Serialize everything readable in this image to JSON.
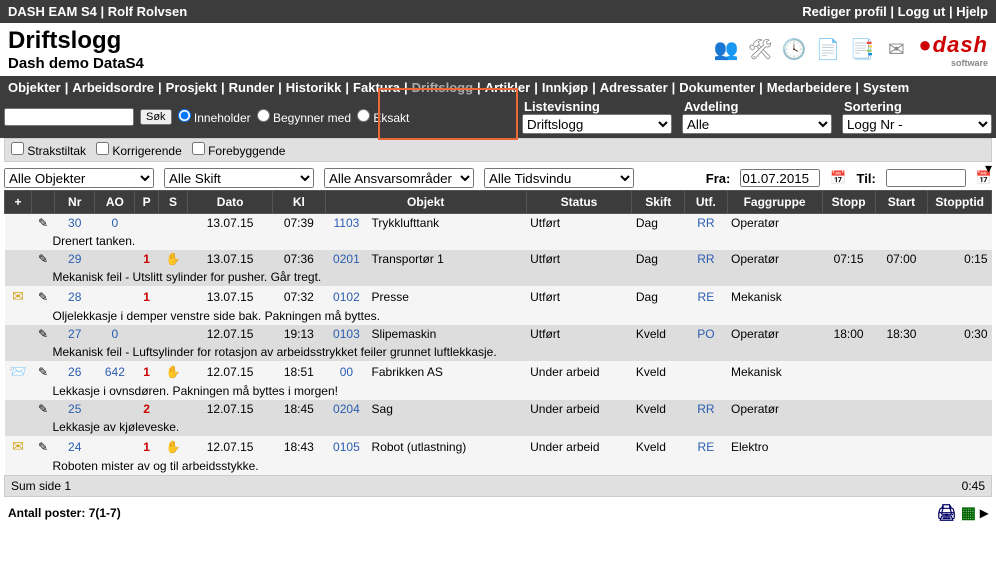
{
  "topbar": {
    "app": "DASH EAM S4",
    "user": "Rolf Rolvsen",
    "links": [
      "Rediger profil",
      "Logg ut",
      "Hjelp"
    ]
  },
  "title": "Driftslogg",
  "subtitle": "Dash demo DataS4",
  "logo": {
    "main": "dash",
    "sub": "software"
  },
  "nav": [
    "Objekter",
    "Arbeidsordre",
    "Prosjekt",
    "Runder",
    "Historikk",
    "Faktura",
    "Driftslogg",
    "Artikler",
    "Innkjøp",
    "Adressater",
    "Dokumenter",
    "Medarbeidere",
    "System"
  ],
  "nav_active": "Driftslogg",
  "search": {
    "button": "Søk",
    "mode_labels": [
      "Inneholder",
      "Begynner med",
      "Eksakt"
    ],
    "checked_mode": 0
  },
  "selectors": {
    "listevisning": {
      "label": "Listevisning",
      "value": "Driftslogg"
    },
    "avdeling": {
      "label": "Avdeling",
      "value": "Alle"
    },
    "sortering": {
      "label": "Sortering",
      "value": "Logg Nr -"
    }
  },
  "filters": {
    "strakstiltak": "Strakstiltak",
    "korrigerende": "Korrigerende",
    "forebyggende": "Forebyggende"
  },
  "dropdowns": {
    "objekter": "Alle Objekter",
    "skift": "Alle Skift",
    "ansvar": "Alle Ansvarsområder",
    "tidsvindu": "Alle Tidsvindu"
  },
  "date": {
    "fra_label": "Fra:",
    "fra_value": "01.07.2015",
    "til_label": "Til:",
    "til_value": ""
  },
  "columns": {
    "plus": "+",
    "nr": "Nr",
    "ao": "AO",
    "p": "P",
    "s": "S",
    "dato": "Dato",
    "kl": "Kl",
    "objekt": "Objekt",
    "status": "Status",
    "skift": "Skift",
    "utf": "Utf.",
    "fag": "Faggruppe",
    "stopp": "Stopp",
    "start": "Start",
    "stopptid": "Stopptid"
  },
  "rows": [
    {
      "mail": false,
      "edit": true,
      "nr": "30",
      "ao": "0",
      "p": "",
      "s": "",
      "dato": "13.07.15",
      "kl": "07:39",
      "objkode": "1103",
      "objekt": "Trykklufttank",
      "status": "Utført",
      "skift": "Dag",
      "utf": "RR",
      "fag": "Operatør",
      "stopp": "",
      "start": "",
      "stopptid": "",
      "desc": "Drenert tanken."
    },
    {
      "mail": false,
      "edit": true,
      "nr": "29",
      "ao": "",
      "p": "1",
      "s": "hand",
      "dato": "13.07.15",
      "kl": "07:36",
      "objkode": "0201",
      "objekt": "Transportør 1",
      "status": "Utført",
      "skift": "Dag",
      "utf": "RR",
      "fag": "Operatør",
      "stopp": "07:15",
      "start": "07:00",
      "stopptid": "0:15",
      "desc": "Mekanisk feil - Utslitt sylinder for pusher. Går tregt."
    },
    {
      "mail": true,
      "edit": true,
      "nr": "28",
      "ao": "",
      "p": "1",
      "s": "",
      "dato": "13.07.15",
      "kl": "07:32",
      "objkode": "0102",
      "objekt": "Presse",
      "status": "Utført",
      "skift": "Dag",
      "utf": "RE",
      "fag": "Mekanisk",
      "stopp": "",
      "start": "",
      "stopptid": "",
      "desc": "Oljelekkasje i demper venstre side bak. Pakningen må byttes."
    },
    {
      "mail": false,
      "edit": true,
      "nr": "27",
      "ao": "0",
      "p": "",
      "s": "",
      "dato": "12.07.15",
      "kl": "19:13",
      "objkode": "0103",
      "objekt": "Slipemaskin",
      "status": "Utført",
      "skift": "Kveld",
      "utf": "PO",
      "fag": "Operatør",
      "stopp": "18:00",
      "start": "18:30",
      "stopptid": "0:30",
      "desc": "Mekanisk feil - Luftsylinder for rotasjon av arbeidsstrykket feiler grunnet luftlekkasje."
    },
    {
      "mail": "open",
      "edit": true,
      "nr": "26",
      "ao": "642",
      "p": "1",
      "s": "hand",
      "dato": "12.07.15",
      "kl": "18:51",
      "objkode": "00",
      "objekt": "Fabrikken AS",
      "status": "Under arbeid",
      "skift": "Kveld",
      "utf": "",
      "fag": "Mekanisk",
      "stopp": "",
      "start": "",
      "stopptid": "",
      "desc": "Lekkasje i ovnsdøren. Pakningen må byttes i morgen!"
    },
    {
      "mail": false,
      "edit": true,
      "nr": "25",
      "ao": "",
      "p": "2",
      "s": "",
      "dato": "12.07.15",
      "kl": "18:45",
      "objkode": "0204",
      "objekt": "Sag",
      "status": "Under arbeid",
      "skift": "Kveld",
      "utf": "RR",
      "fag": "Operatør",
      "stopp": "",
      "start": "",
      "stopptid": "",
      "desc": "Lekkasje av kjøleveske."
    },
    {
      "mail": true,
      "edit": true,
      "nr": "24",
      "ao": "",
      "p": "1",
      "s": "hand",
      "dato": "12.07.15",
      "kl": "18:43",
      "objkode": "0105",
      "objekt": "Robot (utlastning)",
      "status": "Under arbeid",
      "skift": "Kveld",
      "utf": "RE",
      "fag": "Elektro",
      "stopp": "",
      "start": "",
      "stopptid": "",
      "desc": "Roboten mister av og til arbeidsstykke."
    }
  ],
  "sum": {
    "label": "Sum side 1",
    "value": "0:45"
  },
  "footer": {
    "count_label": "Antall poster:",
    "count": "7(1-7)"
  }
}
